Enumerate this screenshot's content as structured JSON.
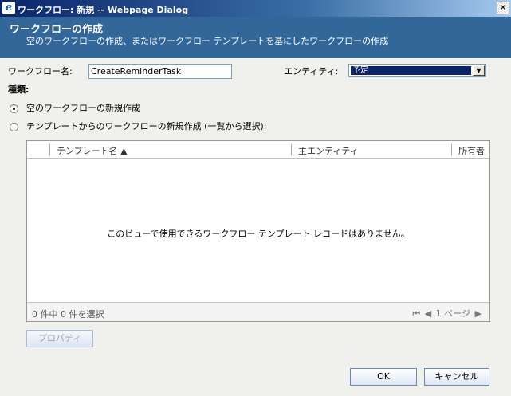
{
  "window": {
    "title": "ワークフロー: 新規 -- Webpage Dialog",
    "close_glyph": "✕"
  },
  "header": {
    "title": "ワークフローの作成",
    "description": "空のワークフローの作成、またはワークフロー テンプレートを基にしたワークフローの作成"
  },
  "form": {
    "name_label": "ワークフロー名:",
    "name_value": "CreateReminderTask",
    "entity_label": "エンティティ:",
    "entity_value": "予定",
    "type_label": "種類:",
    "options": [
      {
        "label": "空のワークフローの新規作成",
        "checked": true
      },
      {
        "label": "テンプレートからのワークフローの新規作成 (一覧から選択):",
        "checked": false
      }
    ]
  },
  "grid": {
    "columns": [
      "テンプレート名 ▲",
      "主エンティティ",
      "所有者"
    ],
    "empty_message": "このビューで使用できるワークフロー テンプレート レコードはありません。",
    "selection_count": "0 件中 0 件を選択",
    "pager": {
      "first": "⏮",
      "prev": "◀",
      "page": "1 ページ",
      "next": "▶"
    }
  },
  "buttons": {
    "properties": "プロパティ",
    "ok": "OK",
    "cancel": "キャンセル"
  }
}
